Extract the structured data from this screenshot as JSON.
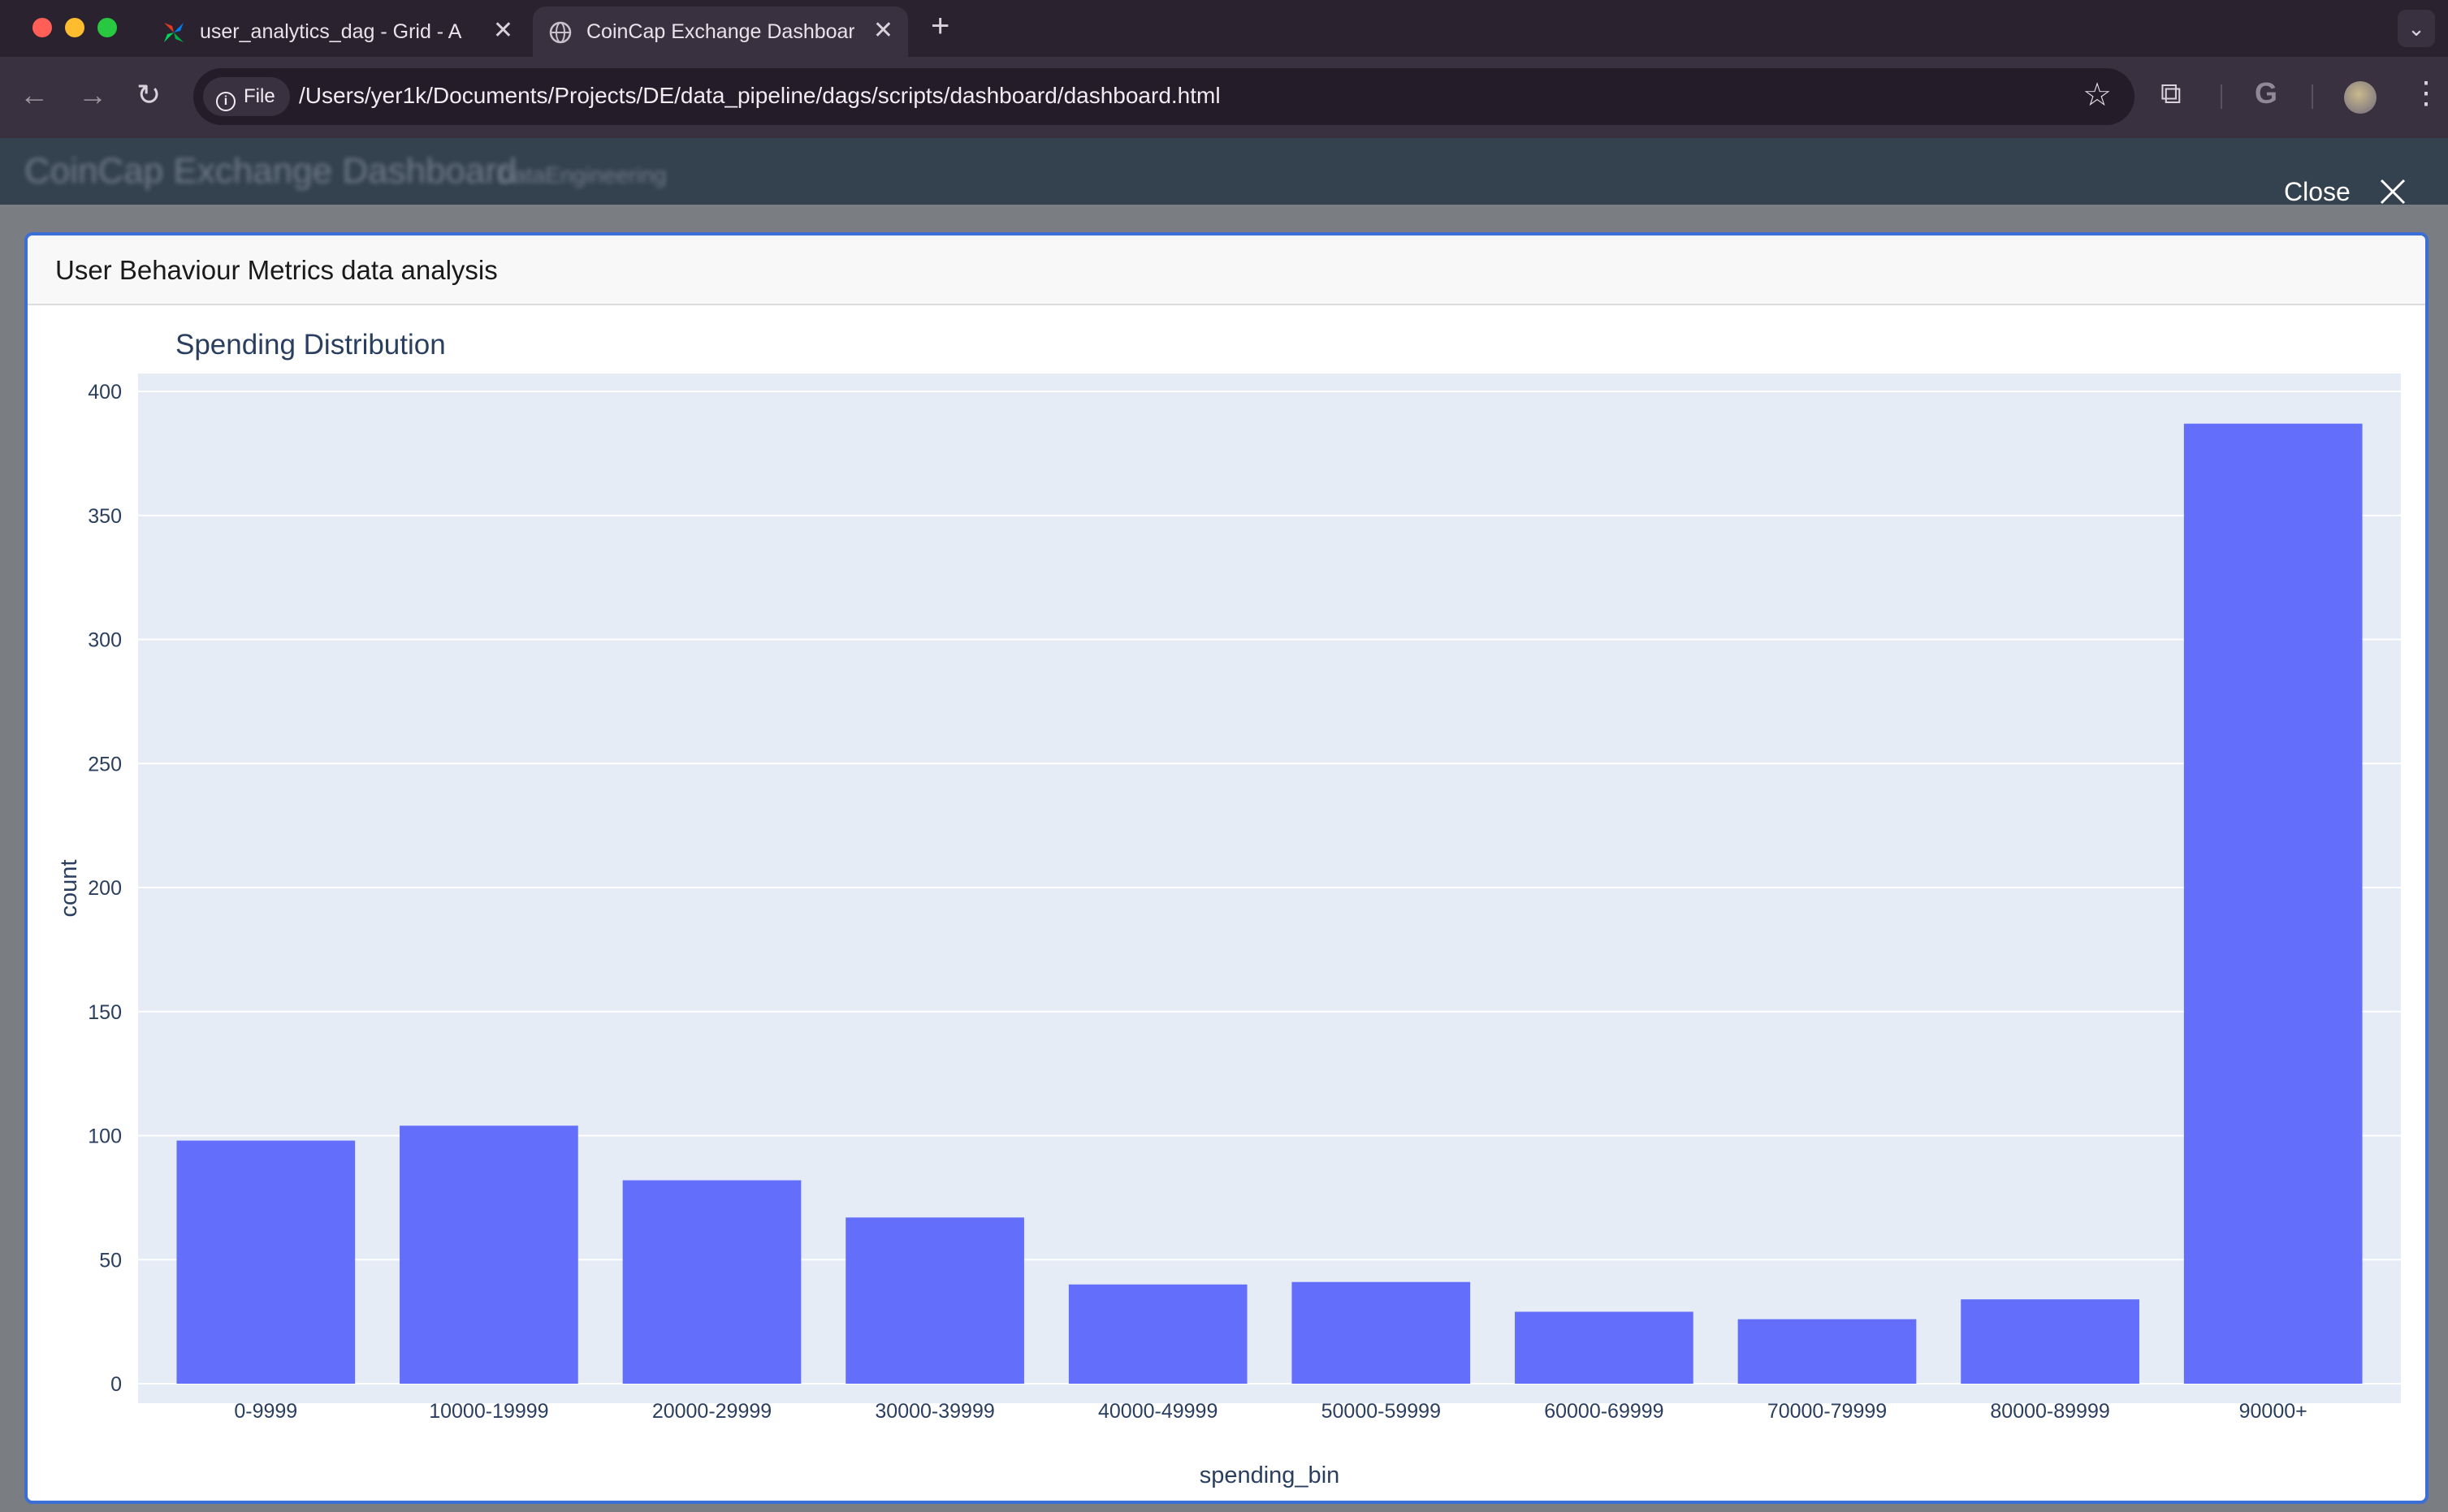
{
  "browser": {
    "tabs": [
      {
        "title": "user_analytics_dag - Grid - A",
        "active": false,
        "icon": "airflow-icon"
      },
      {
        "title": "CoinCap Exchange Dashboard",
        "active": true,
        "icon": "globe-icon"
      }
    ],
    "chip_label": "File",
    "url": "/Users/yer1k/Documents/Projects/DE/data_pipeline/dags/scripts/dashboard/dashboard.html"
  },
  "page": {
    "title": "CoinCap Exchange Dashboard",
    "subtitle": "DataEngineering",
    "close_label": "Close"
  },
  "modal": {
    "title": "User Behaviour Metrics data analysis"
  },
  "colors": {
    "bar": "#636efa",
    "plot_bg": "#e5ecf6",
    "modal_border": "#3b6fd6"
  },
  "chart_data": {
    "type": "bar",
    "title": "Spending Distribution",
    "xlabel": "spending_bin",
    "ylabel": "count",
    "categories": [
      "0-9999",
      "10000-19999",
      "20000-29999",
      "30000-39999",
      "40000-49999",
      "50000-59999",
      "60000-69999",
      "70000-79999",
      "80000-89999",
      "90000+"
    ],
    "values": [
      98,
      104,
      82,
      67,
      40,
      41,
      29,
      26,
      34,
      387
    ],
    "ylim": [
      0,
      400
    ],
    "yticks": [
      0,
      50,
      100,
      150,
      200,
      250,
      300,
      350,
      400
    ],
    "grid": true
  }
}
